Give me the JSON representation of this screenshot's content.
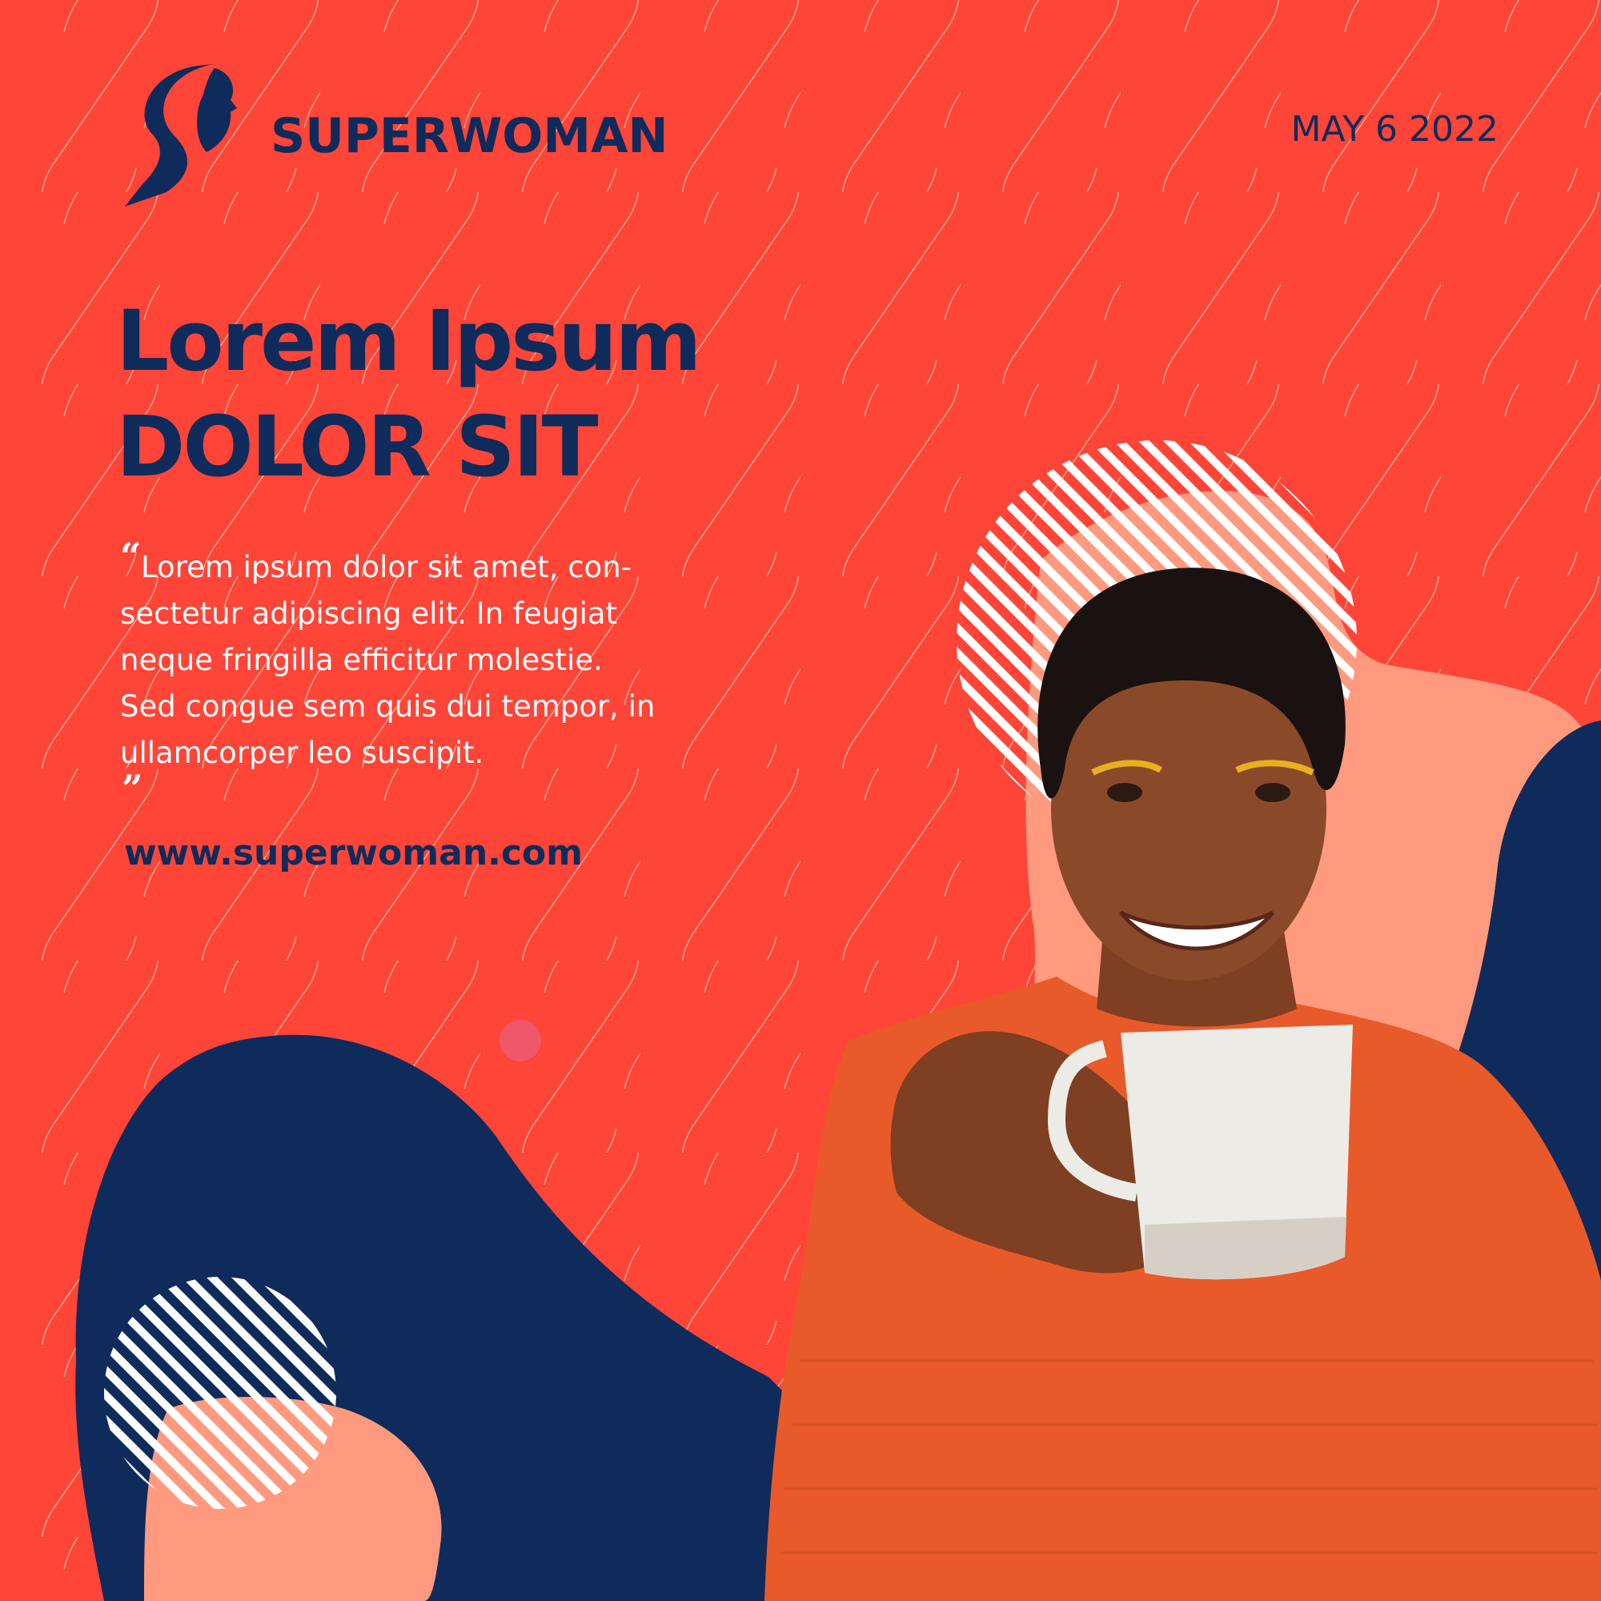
{
  "brand": {
    "name": "SUPERWOMAN",
    "logo_icon": "woman-silhouette-s-logo-icon"
  },
  "date": "MAY 6 2022",
  "headline": {
    "line1": "Lorem Ipsum",
    "line2": "DOLOR SIT"
  },
  "quote": {
    "open_mark": "“",
    "close_mark": "”",
    "lines": [
      "Lorem ipsum dolor sit amet, con-",
      "sectetur adipiscing elit. In feugiat",
      "neque fringilla efficitur molestie.",
      "Sed congue sem quis dui tempor, in",
      "ullamcorper leo suscipit."
    ]
  },
  "website": "www.superwoman.com",
  "colors": {
    "background": "#FF4438",
    "navy": "#0F2B5B",
    "peach": "#FF9A7E",
    "white": "#FFFFFF",
    "sweater": "#E85A2A",
    "skin": "#8A4A2A"
  },
  "photo": {
    "subject": "smiling-woman-holding-mug-photo"
  }
}
